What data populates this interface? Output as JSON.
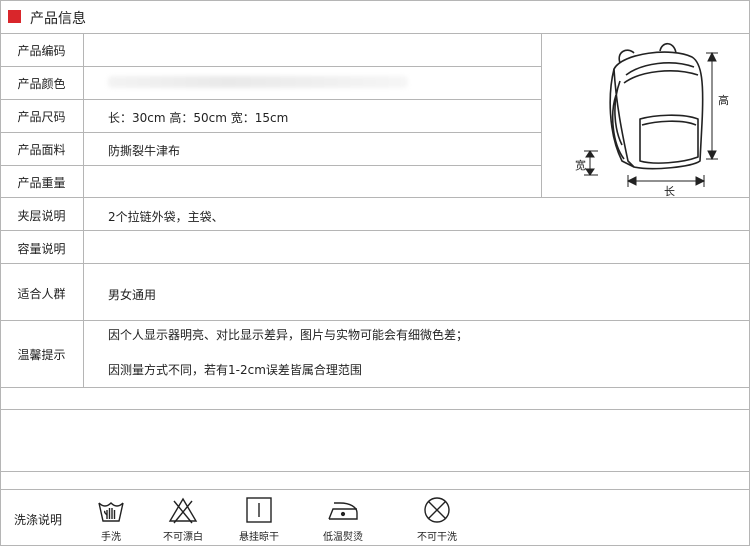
{
  "header": {
    "title": "产品信息",
    "accent_color": "#d9262b"
  },
  "rows": [
    {
      "label": "产品编码",
      "value": ""
    },
    {
      "label": "产品颜色",
      "value": ""
    },
    {
      "label": "产品尺码",
      "value": "长：30cm   高：50cm   宽：15cm"
    },
    {
      "label": "产品面料",
      "value": "防撕裂牛津布"
    },
    {
      "label": "产品重量",
      "value": ""
    },
    {
      "label": "夹层说明",
      "value": "2个拉链外袋，主袋、"
    },
    {
      "label": "容量说明",
      "value": ""
    },
    {
      "label": "适合人群",
      "value": "男女通用"
    },
    {
      "label": "温馨提示",
      "value": "因个人显示器明亮、对比显示差异，图片与实物可能会有细微色差；",
      "value2": "因测量方式不同，若有1-2cm误差皆属合理范围"
    }
  ],
  "diagram": {
    "height_label": "高",
    "width_label": "宽",
    "length_label": "长"
  },
  "care": {
    "label": "洗涤说明",
    "items": [
      {
        "icon": "hand-wash-icon",
        "label": "手洗"
      },
      {
        "icon": "no-bleach-icon",
        "label": "不可漂白"
      },
      {
        "icon": "hang-dry-icon",
        "label": "悬挂晾干"
      },
      {
        "icon": "low-iron-icon",
        "label": "低温熨烫"
      },
      {
        "icon": "no-dry-clean-icon",
        "label": "不可干洗"
      }
    ]
  }
}
